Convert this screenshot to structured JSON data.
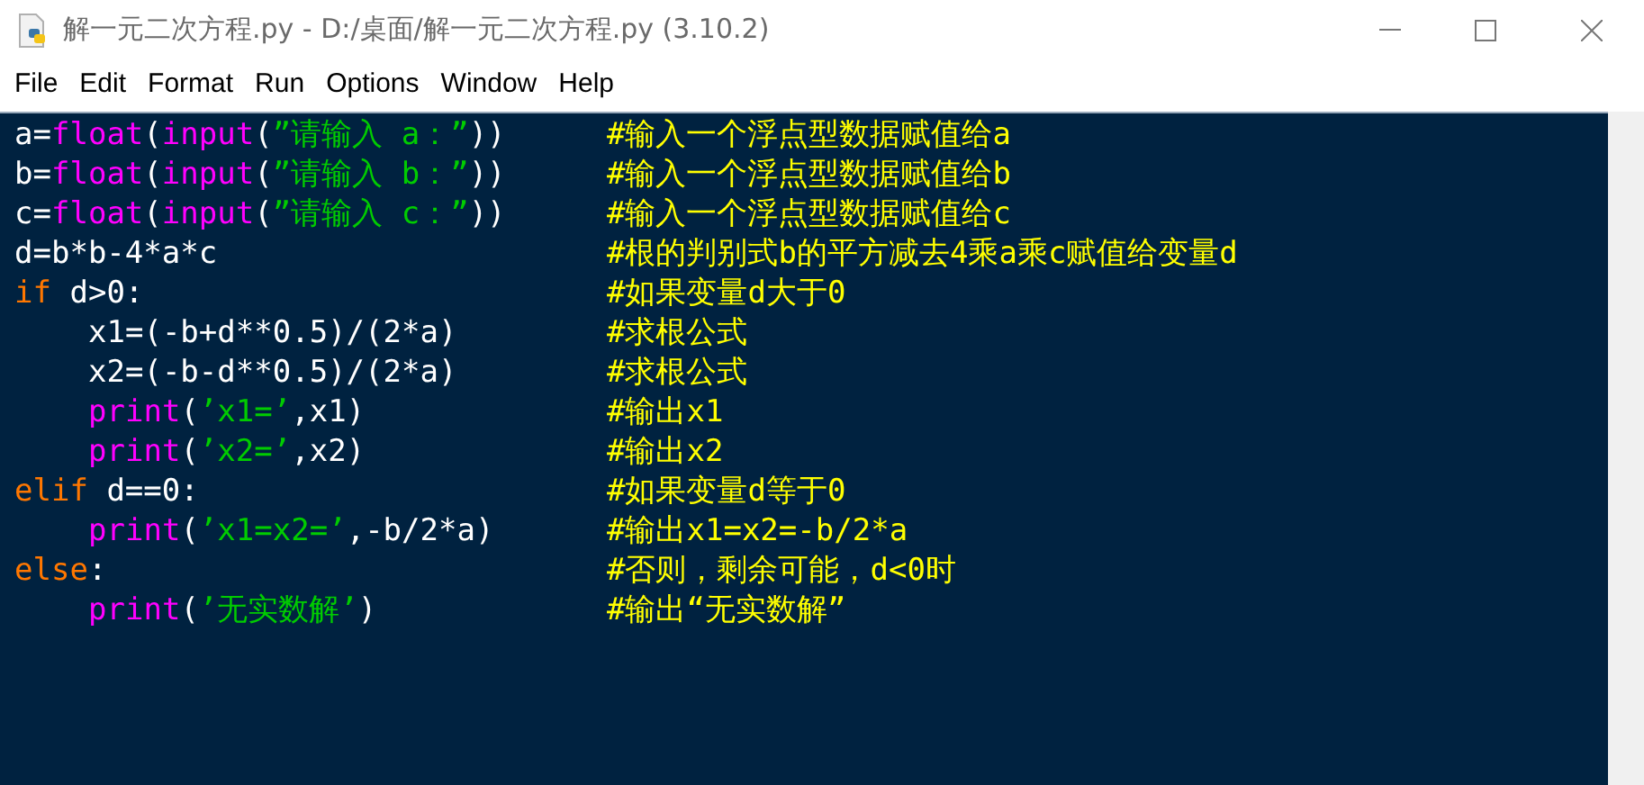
{
  "window": {
    "title": "解一元二次方程.py - D:/桌面/解一元二次方程.py (3.10.2)"
  },
  "menu": [
    "File",
    "Edit",
    "Format",
    "Run",
    "Options",
    "Window",
    "Help"
  ],
  "editor": {
    "lines": [
      {
        "indented": false,
        "tokens": [
          {
            "kind": "plain",
            "text": "a="
          },
          {
            "kind": "builtin",
            "text": "float"
          },
          {
            "kind": "plain",
            "text": "("
          },
          {
            "kind": "builtin",
            "text": "input"
          },
          {
            "kind": "plain",
            "text": "("
          },
          {
            "kind": "string",
            "text": "”请输入 a：”"
          },
          {
            "kind": "plain",
            "text": "))"
          }
        ],
        "comment": "#输入一个浮点型数据赋值给a"
      },
      {
        "indented": false,
        "tokens": [
          {
            "kind": "plain",
            "text": "b="
          },
          {
            "kind": "builtin",
            "text": "float"
          },
          {
            "kind": "plain",
            "text": "("
          },
          {
            "kind": "builtin",
            "text": "input"
          },
          {
            "kind": "plain",
            "text": "("
          },
          {
            "kind": "string",
            "text": "”请输入 b：”"
          },
          {
            "kind": "plain",
            "text": "))"
          }
        ],
        "comment": "#输入一个浮点型数据赋值给b"
      },
      {
        "indented": false,
        "tokens": [
          {
            "kind": "plain",
            "text": "c="
          },
          {
            "kind": "builtin",
            "text": "float"
          },
          {
            "kind": "plain",
            "text": "("
          },
          {
            "kind": "builtin",
            "text": "input"
          },
          {
            "kind": "plain",
            "text": "("
          },
          {
            "kind": "string",
            "text": "”请输入 c：”"
          },
          {
            "kind": "plain",
            "text": "))"
          }
        ],
        "comment": "#输入一个浮点型数据赋值给c"
      },
      {
        "indented": false,
        "tokens": [
          {
            "kind": "plain",
            "text": "d=b*b-4*a*c"
          }
        ],
        "comment": "#根的判别式b的平方减去4乘a乘c赋值给变量d"
      },
      {
        "indented": false,
        "tokens": [
          {
            "kind": "keyword",
            "text": "if"
          },
          {
            "kind": "plain",
            "text": " d>0:"
          }
        ],
        "comment": "#如果变量d大于0"
      },
      {
        "indented": true,
        "tokens": [
          {
            "kind": "plain",
            "text": "x1=(-b+d**0.5)/(2*a)"
          }
        ],
        "comment": "#求根公式"
      },
      {
        "indented": true,
        "tokens": [
          {
            "kind": "plain",
            "text": "x2=(-b-d**0.5)/(2*a)"
          }
        ],
        "comment": "#求根公式"
      },
      {
        "indented": true,
        "tokens": [
          {
            "kind": "builtin",
            "text": "print"
          },
          {
            "kind": "plain",
            "text": "("
          },
          {
            "kind": "string",
            "text": "’x1=’"
          },
          {
            "kind": "plain",
            "text": ",x1)"
          }
        ],
        "comment": "#输出x1"
      },
      {
        "indented": true,
        "tokens": [
          {
            "kind": "builtin",
            "text": "print"
          },
          {
            "kind": "plain",
            "text": "("
          },
          {
            "kind": "string",
            "text": "’x2=’"
          },
          {
            "kind": "plain",
            "text": ",x2)"
          }
        ],
        "comment": "#输出x2"
      },
      {
        "indented": false,
        "tokens": [
          {
            "kind": "keyword",
            "text": "elif"
          },
          {
            "kind": "plain",
            "text": " d==0:"
          }
        ],
        "comment": "#如果变量d等于0"
      },
      {
        "indented": true,
        "tokens": [
          {
            "kind": "builtin",
            "text": "print"
          },
          {
            "kind": "plain",
            "text": "("
          },
          {
            "kind": "string",
            "text": "’x1=x2=’"
          },
          {
            "kind": "plain",
            "text": ",-b/2*a)"
          }
        ],
        "comment": "#输出x1=x2=-b/2*a"
      },
      {
        "indented": false,
        "tokens": [
          {
            "kind": "keyword",
            "text": "else"
          },
          {
            "kind": "plain",
            "text": ":"
          }
        ],
        "comment": "#否则，剩余可能，d<0时"
      },
      {
        "indented": true,
        "tokens": [
          {
            "kind": "builtin",
            "text": "print"
          },
          {
            "kind": "plain",
            "text": "("
          },
          {
            "kind": "string",
            "text": "’无实数解’"
          },
          {
            "kind": "plain",
            "text": ")"
          }
        ],
        "comment": "#输出“无实数解”"
      }
    ]
  }
}
